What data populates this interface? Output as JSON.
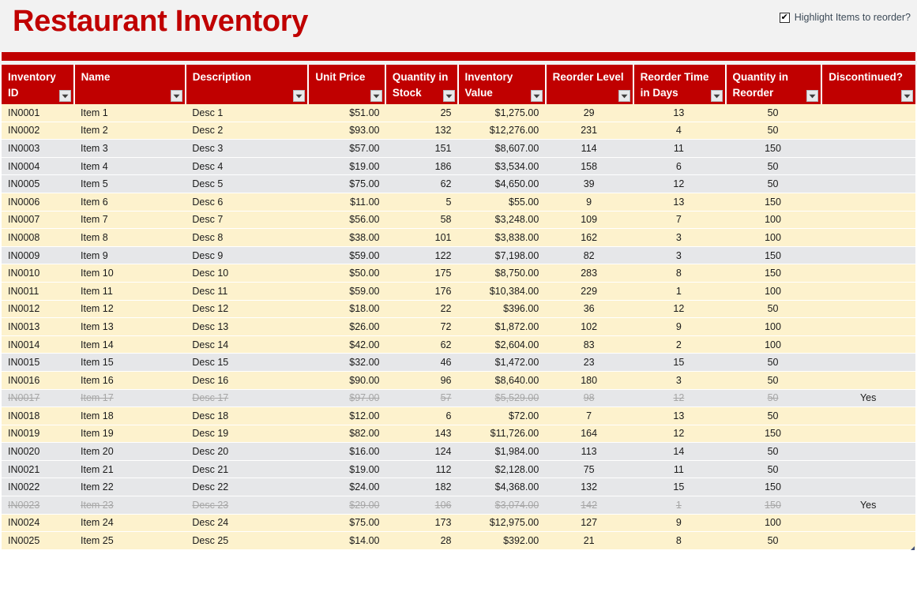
{
  "header": {
    "title": "Restaurant Inventory",
    "highlight_toggle": {
      "label": "Highlight Items to reorder?",
      "checked": true,
      "check_glyph": "✔"
    },
    "accent_color": "#c00000",
    "highlight_row_color": "#fdf2cd",
    "normal_row_color": "#e6e7e9"
  },
  "table": {
    "columns": [
      {
        "key": "id",
        "label": "Inventory ID",
        "filter_icon": "chevron-down-icon"
      },
      {
        "key": "name",
        "label": "Name",
        "filter_icon": "chevron-down-icon"
      },
      {
        "key": "description",
        "label": "Description",
        "filter_icon": "chevron-down-icon"
      },
      {
        "key": "unit_price",
        "label": "Unit Price",
        "filter_icon": "chevron-down-icon"
      },
      {
        "key": "qty_in_stock",
        "label": "Quantity in Stock",
        "filter_icon": "chevron-down-icon"
      },
      {
        "key": "inv_value",
        "label": "Inventory Value",
        "filter_icon": "chevron-down-icon"
      },
      {
        "key": "reorder_level",
        "label": "Reorder Level",
        "filter_icon": "chevron-down-icon"
      },
      {
        "key": "reorder_time",
        "label": "Reorder Time in Days",
        "filter_icon": "chevron-down-icon"
      },
      {
        "key": "qty_reorder",
        "label": "Quantity in Reorder",
        "filter_icon": "chevron-down-icon"
      },
      {
        "key": "discontinued",
        "label": "Discontinued?",
        "filter_icon": "chevron-down-icon"
      }
    ],
    "rows": [
      {
        "id": "IN0001",
        "name": "Item 1",
        "description": "Desc 1",
        "unit_price": "$51.00",
        "qty_in_stock": "25",
        "inv_value": "$1,275.00",
        "reorder_level": "29",
        "reorder_time": "13",
        "qty_reorder": "50",
        "discontinued": "",
        "highlight": true,
        "struck": false
      },
      {
        "id": "IN0002",
        "name": "Item 2",
        "description": "Desc 2",
        "unit_price": "$93.00",
        "qty_in_stock": "132",
        "inv_value": "$12,276.00",
        "reorder_level": "231",
        "reorder_time": "4",
        "qty_reorder": "50",
        "discontinued": "",
        "highlight": true,
        "struck": false
      },
      {
        "id": "IN0003",
        "name": "Item 3",
        "description": "Desc 3",
        "unit_price": "$57.00",
        "qty_in_stock": "151",
        "inv_value": "$8,607.00",
        "reorder_level": "114",
        "reorder_time": "11",
        "qty_reorder": "150",
        "discontinued": "",
        "highlight": false,
        "struck": false
      },
      {
        "id": "IN0004",
        "name": "Item 4",
        "description": "Desc 4",
        "unit_price": "$19.00",
        "qty_in_stock": "186",
        "inv_value": "$3,534.00",
        "reorder_level": "158",
        "reorder_time": "6",
        "qty_reorder": "50",
        "discontinued": "",
        "highlight": false,
        "struck": false
      },
      {
        "id": "IN0005",
        "name": "Item 5",
        "description": "Desc 5",
        "unit_price": "$75.00",
        "qty_in_stock": "62",
        "inv_value": "$4,650.00",
        "reorder_level": "39",
        "reorder_time": "12",
        "qty_reorder": "50",
        "discontinued": "",
        "highlight": false,
        "struck": false
      },
      {
        "id": "IN0006",
        "name": "Item 6",
        "description": "Desc 6",
        "unit_price": "$11.00",
        "qty_in_stock": "5",
        "inv_value": "$55.00",
        "reorder_level": "9",
        "reorder_time": "13",
        "qty_reorder": "150",
        "discontinued": "",
        "highlight": true,
        "struck": false
      },
      {
        "id": "IN0007",
        "name": "Item 7",
        "description": "Desc 7",
        "unit_price": "$56.00",
        "qty_in_stock": "58",
        "inv_value": "$3,248.00",
        "reorder_level": "109",
        "reorder_time": "7",
        "qty_reorder": "100",
        "discontinued": "",
        "highlight": true,
        "struck": false
      },
      {
        "id": "IN0008",
        "name": "Item 8",
        "description": "Desc 8",
        "unit_price": "$38.00",
        "qty_in_stock": "101",
        "inv_value": "$3,838.00",
        "reorder_level": "162",
        "reorder_time": "3",
        "qty_reorder": "100",
        "discontinued": "",
        "highlight": true,
        "struck": false
      },
      {
        "id": "IN0009",
        "name": "Item 9",
        "description": "Desc 9",
        "unit_price": "$59.00",
        "qty_in_stock": "122",
        "inv_value": "$7,198.00",
        "reorder_level": "82",
        "reorder_time": "3",
        "qty_reorder": "150",
        "discontinued": "",
        "highlight": false,
        "struck": false
      },
      {
        "id": "IN0010",
        "name": "Item 10",
        "description": "Desc 10",
        "unit_price": "$50.00",
        "qty_in_stock": "175",
        "inv_value": "$8,750.00",
        "reorder_level": "283",
        "reorder_time": "8",
        "qty_reorder": "150",
        "discontinued": "",
        "highlight": true,
        "struck": false
      },
      {
        "id": "IN0011",
        "name": "Item 11",
        "description": "Desc 11",
        "unit_price": "$59.00",
        "qty_in_stock": "176",
        "inv_value": "$10,384.00",
        "reorder_level": "229",
        "reorder_time": "1",
        "qty_reorder": "100",
        "discontinued": "",
        "highlight": true,
        "struck": false
      },
      {
        "id": "IN0012",
        "name": "Item 12",
        "description": "Desc 12",
        "unit_price": "$18.00",
        "qty_in_stock": "22",
        "inv_value": "$396.00",
        "reorder_level": "36",
        "reorder_time": "12",
        "qty_reorder": "50",
        "discontinued": "",
        "highlight": true,
        "struck": false
      },
      {
        "id": "IN0013",
        "name": "Item 13",
        "description": "Desc 13",
        "unit_price": "$26.00",
        "qty_in_stock": "72",
        "inv_value": "$1,872.00",
        "reorder_level": "102",
        "reorder_time": "9",
        "qty_reorder": "100",
        "discontinued": "",
        "highlight": true,
        "struck": false
      },
      {
        "id": "IN0014",
        "name": "Item 14",
        "description": "Desc 14",
        "unit_price": "$42.00",
        "qty_in_stock": "62",
        "inv_value": "$2,604.00",
        "reorder_level": "83",
        "reorder_time": "2",
        "qty_reorder": "100",
        "discontinued": "",
        "highlight": true,
        "struck": false
      },
      {
        "id": "IN0015",
        "name": "Item 15",
        "description": "Desc 15",
        "unit_price": "$32.00",
        "qty_in_stock": "46",
        "inv_value": "$1,472.00",
        "reorder_level": "23",
        "reorder_time": "15",
        "qty_reorder": "50",
        "discontinued": "",
        "highlight": false,
        "struck": false
      },
      {
        "id": "IN0016",
        "name": "Item 16",
        "description": "Desc 16",
        "unit_price": "$90.00",
        "qty_in_stock": "96",
        "inv_value": "$8,640.00",
        "reorder_level": "180",
        "reorder_time": "3",
        "qty_reorder": "50",
        "discontinued": "",
        "highlight": true,
        "struck": false
      },
      {
        "id": "IN0017",
        "name": "Item 17",
        "description": "Desc 17",
        "unit_price": "$97.00",
        "qty_in_stock": "57",
        "inv_value": "$5,529.00",
        "reorder_level": "98",
        "reorder_time": "12",
        "qty_reorder": "50",
        "discontinued": "Yes",
        "highlight": false,
        "struck": true
      },
      {
        "id": "IN0018",
        "name": "Item 18",
        "description": "Desc 18",
        "unit_price": "$12.00",
        "qty_in_stock": "6",
        "inv_value": "$72.00",
        "reorder_level": "7",
        "reorder_time": "13",
        "qty_reorder": "50",
        "discontinued": "",
        "highlight": true,
        "struck": false
      },
      {
        "id": "IN0019",
        "name": "Item 19",
        "description": "Desc 19",
        "unit_price": "$82.00",
        "qty_in_stock": "143",
        "inv_value": "$11,726.00",
        "reorder_level": "164",
        "reorder_time": "12",
        "qty_reorder": "150",
        "discontinued": "",
        "highlight": true,
        "struck": false
      },
      {
        "id": "IN0020",
        "name": "Item 20",
        "description": "Desc 20",
        "unit_price": "$16.00",
        "qty_in_stock": "124",
        "inv_value": "$1,984.00",
        "reorder_level": "113",
        "reorder_time": "14",
        "qty_reorder": "50",
        "discontinued": "",
        "highlight": false,
        "struck": false
      },
      {
        "id": "IN0021",
        "name": "Item 21",
        "description": "Desc 21",
        "unit_price": "$19.00",
        "qty_in_stock": "112",
        "inv_value": "$2,128.00",
        "reorder_level": "75",
        "reorder_time": "11",
        "qty_reorder": "50",
        "discontinued": "",
        "highlight": false,
        "struck": false
      },
      {
        "id": "IN0022",
        "name": "Item 22",
        "description": "Desc 22",
        "unit_price": "$24.00",
        "qty_in_stock": "182",
        "inv_value": "$4,368.00",
        "reorder_level": "132",
        "reorder_time": "15",
        "qty_reorder": "150",
        "discontinued": "",
        "highlight": false,
        "struck": false
      },
      {
        "id": "IN0023",
        "name": "Item 23",
        "description": "Desc 23",
        "unit_price": "$29.00",
        "qty_in_stock": "106",
        "inv_value": "$3,074.00",
        "reorder_level": "142",
        "reorder_time": "1",
        "qty_reorder": "150",
        "discontinued": "Yes",
        "highlight": false,
        "struck": true
      },
      {
        "id": "IN0024",
        "name": "Item 24",
        "description": "Desc 24",
        "unit_price": "$75.00",
        "qty_in_stock": "173",
        "inv_value": "$12,975.00",
        "reorder_level": "127",
        "reorder_time": "9",
        "qty_reorder": "100",
        "discontinued": "",
        "highlight": true,
        "struck": false
      },
      {
        "id": "IN0025",
        "name": "Item 25",
        "description": "Desc 25",
        "unit_price": "$14.00",
        "qty_in_stock": "28",
        "inv_value": "$392.00",
        "reorder_level": "21",
        "reorder_time": "8",
        "qty_reorder": "50",
        "discontinued": "",
        "highlight": true,
        "struck": false
      }
    ]
  }
}
